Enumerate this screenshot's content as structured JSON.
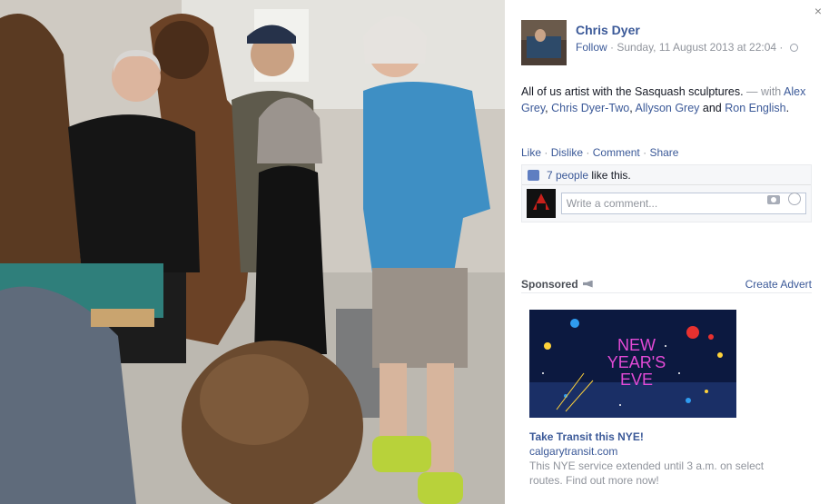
{
  "photo": {
    "alt_subject": "group photo"
  },
  "close_glyph": "×",
  "post": {
    "author": "Chris Dyer",
    "follow_label": "Follow",
    "separator": "·",
    "timestamp": "Sunday, 11 August 2013 at 22:04",
    "caption_text": "All of us artist with the Sasquash sculptures.",
    "with_label": "— with",
    "tagged": [
      "Alex Grey",
      "Chris Dyer-Two",
      "Allyson Grey",
      "Ron English"
    ],
    "tag_sep_1": ",",
    "tag_sep_2": ",",
    "tag_sep_3": "and",
    "caption_end": "."
  },
  "actions": {
    "like": "Like",
    "dislike": "Dislike",
    "comment": "Comment",
    "share": "Share",
    "sep": "·"
  },
  "likes": {
    "count_link": "7 people",
    "suffix": "like this."
  },
  "comment": {
    "placeholder": "Write a comment..."
  },
  "sponsored": {
    "label": "Sponsored",
    "create_advert": "Create Advert"
  },
  "ad": {
    "image_line1": "NEW",
    "image_line2": "YEAR'S",
    "image_line3": "EVE",
    "title": "Take Transit this NYE!",
    "url": "calgarytransit.com",
    "description": "This NYE service extended until 3 a.m. on select routes. Find out more now!"
  },
  "colors": {
    "link": "#3b5998",
    "meta": "#90949c",
    "ad_bg": "#0c1940",
    "ad_text": "#e34ad6"
  }
}
